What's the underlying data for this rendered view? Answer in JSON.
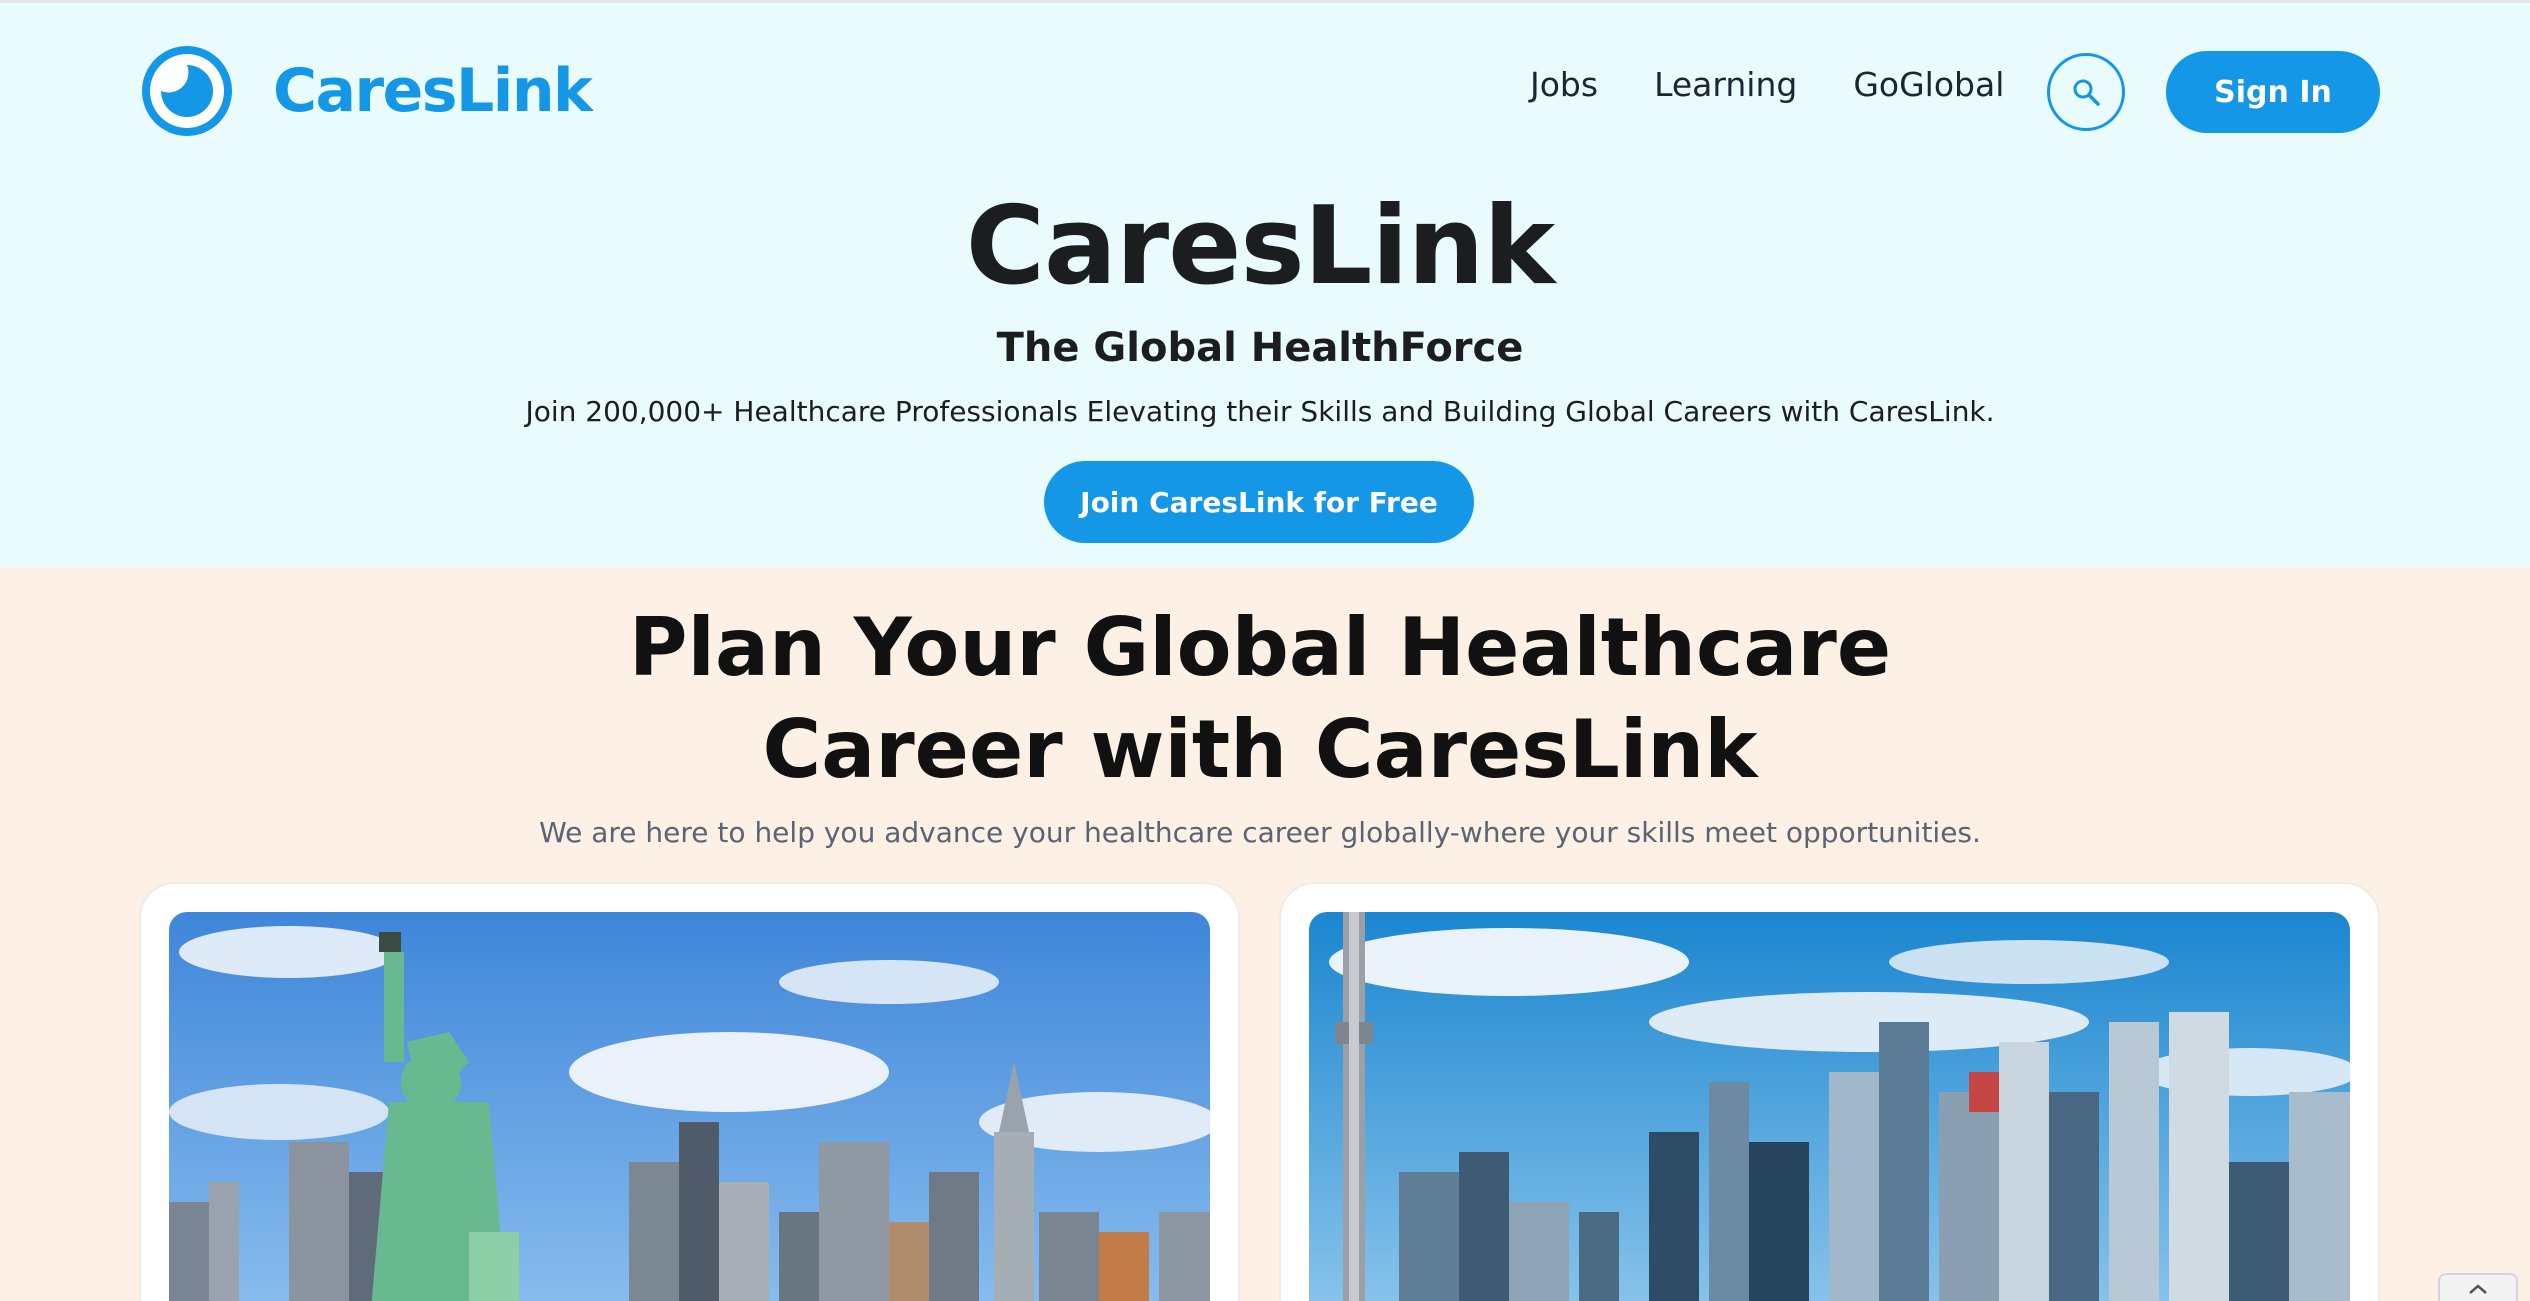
{
  "nav": {
    "brand": "CaresLink",
    "links": [
      "Jobs",
      "Learning",
      "GoGlobal"
    ],
    "search_icon": "search-icon",
    "signin_label": "Sign In"
  },
  "hero": {
    "title": "CaresLink",
    "subtitle": "The Global HealthForce",
    "description": "Join 200,000+ Healthcare Professionals Elevating their Skills and Building Global Careers with CaresLink.",
    "cta_label": "Join CaresLink for Free"
  },
  "plan": {
    "title_line1": "Plan Your Global Healthcare",
    "title_line2": "Career with CaresLink",
    "description": "We are here to help you advance your healthcare career globally-where your skills meet opportunities.",
    "cards": [
      {
        "image": "new-york-skyline-statue-of-liberty"
      },
      {
        "image": "toronto-skyline-cn-tower"
      }
    ]
  },
  "colors": {
    "brand": "#1497e6",
    "hero_bg": "#e9fbfd",
    "plan_bg": "#fdf1e5",
    "heading": "#1b1d1f",
    "muted": "#5a6473"
  }
}
